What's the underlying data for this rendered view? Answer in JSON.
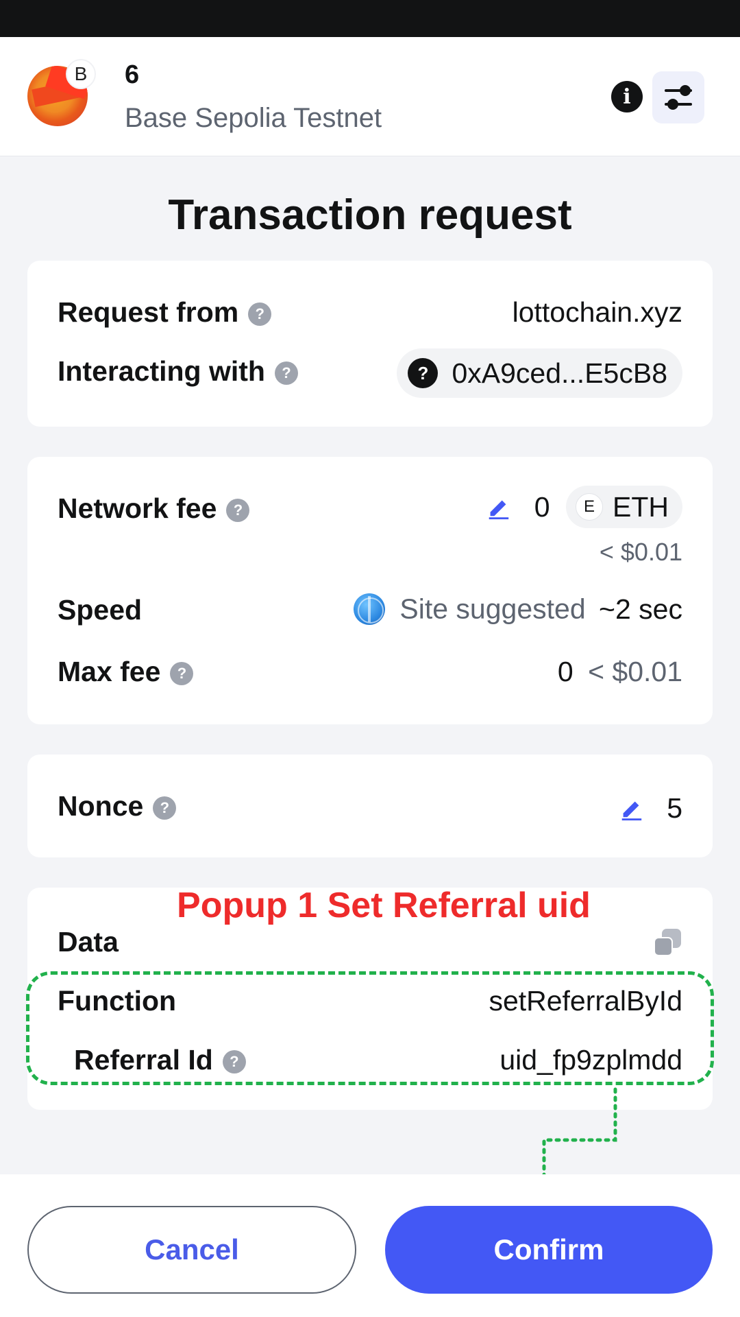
{
  "header": {
    "account_name": "6",
    "network_badge": "B",
    "network_name": "Base Sepolia Testnet",
    "info_icon": "i"
  },
  "page_title": "Transaction request",
  "origin_card": {
    "request_from_label": "Request from",
    "request_from_value": "lottochain.xyz",
    "interacting_with_label": "Interacting with",
    "interacting_with_value": "0xA9ced...E5cB8"
  },
  "fee_card": {
    "network_fee_label": "Network fee",
    "network_fee_value": "0",
    "currency_badge": "E",
    "currency": "ETH",
    "network_fee_fiat": "< $0.01",
    "speed_label": "Speed",
    "speed_source": "Site suggested",
    "speed_time": "~2 sec",
    "max_fee_label": "Max fee",
    "max_fee_value": "0",
    "max_fee_fiat": "< $0.01"
  },
  "nonce_card": {
    "label": "Nonce",
    "value": "5"
  },
  "data_card": {
    "label": "Data",
    "function_label": "Function",
    "function_value": "setReferralById",
    "referral_label": "Referral Id",
    "referral_value": "uid_fp9zplmdd"
  },
  "annotation": {
    "title": "Popup 1 Set Referral uid",
    "color": "#ee2b2b",
    "highlight_color": "#21b14c"
  },
  "footer": {
    "cancel_label": "Cancel",
    "confirm_label": "Confirm"
  },
  "colors": {
    "accent": "#4358f5",
    "background": "#f3f4f7",
    "card": "#ffffff"
  }
}
